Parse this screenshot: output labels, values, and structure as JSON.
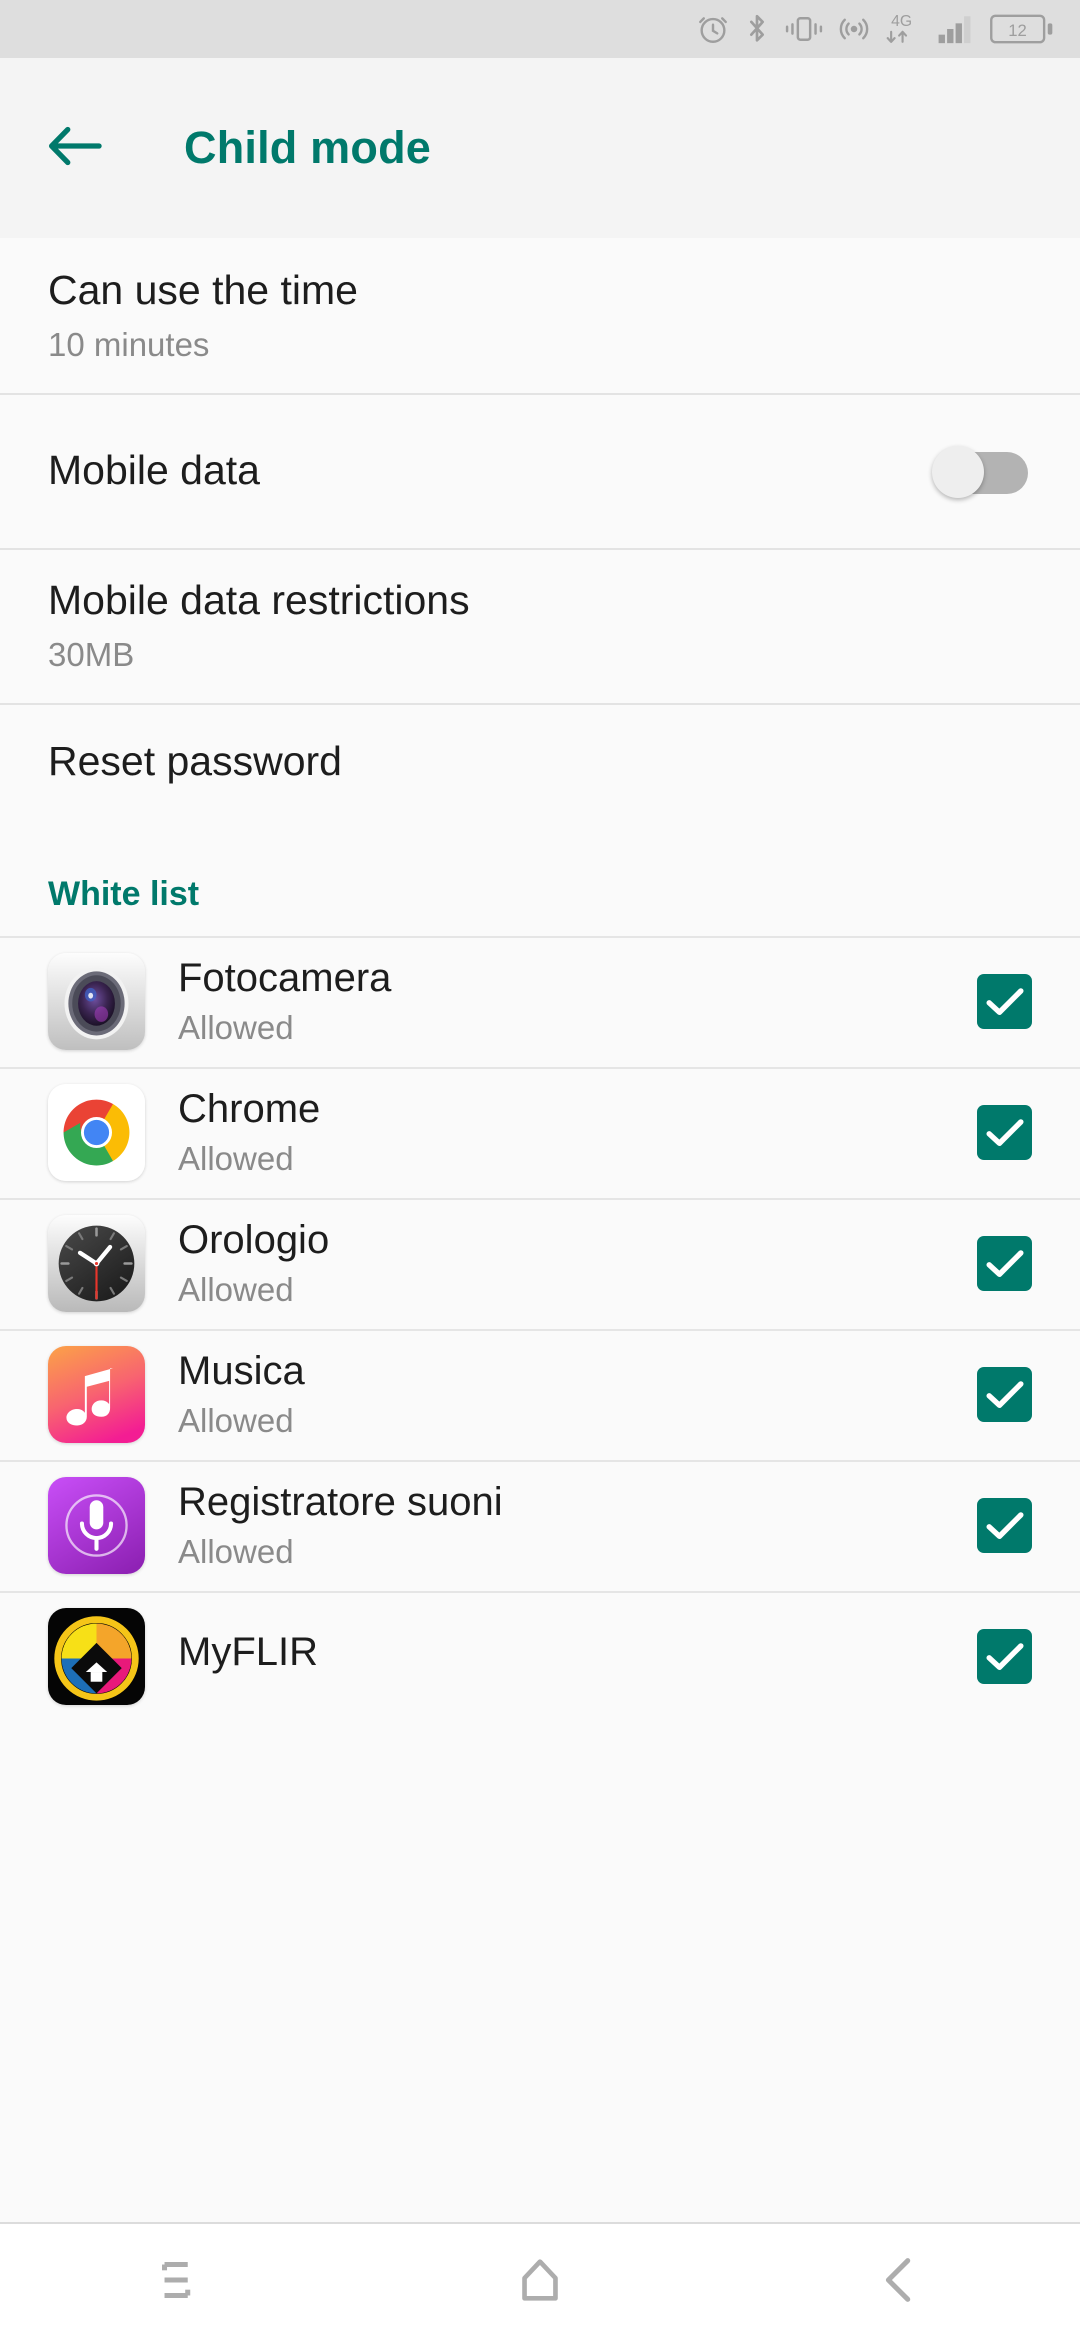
{
  "statusbar": {
    "icons": [
      {
        "name": "alarm-icon",
        "label": "Alarm set"
      },
      {
        "name": "bluetooth-icon",
        "label": "Bluetooth"
      },
      {
        "name": "vibrate-icon",
        "label": "Vibrate mode"
      },
      {
        "name": "hotspot-icon",
        "label": "Hotspot"
      },
      {
        "name": "mobile-network-icon",
        "label": "4G"
      },
      {
        "name": "signal-bars-icon",
        "label": "Signal"
      },
      {
        "name": "battery-icon",
        "label": "Battery"
      }
    ],
    "network_type": "4G",
    "battery_level": "12"
  },
  "appbar": {
    "title": "Child mode",
    "back_icon": "arrow-left-icon"
  },
  "settings": [
    {
      "key": "can-use-the-time",
      "title": "Can use the time",
      "subtitle": "10 minutes",
      "control": "none"
    },
    {
      "key": "mobile-data",
      "title": "Mobile data",
      "subtitle": "",
      "control": "toggle",
      "toggle_on": false
    },
    {
      "key": "mobile-data-restrictions",
      "title": "Mobile data restrictions",
      "subtitle": "30MB",
      "control": "none"
    },
    {
      "key": "reset-password",
      "title": "Reset password",
      "subtitle": "",
      "control": "none"
    }
  ],
  "whitelist": {
    "header": "White list",
    "apps": [
      {
        "key": "fotocamera",
        "name": "Fotocamera",
        "state": "Allowed",
        "checked": true,
        "icon": "camera-icon"
      },
      {
        "key": "chrome",
        "name": "Chrome",
        "state": "Allowed",
        "checked": true,
        "icon": "chrome-icon"
      },
      {
        "key": "orologio",
        "name": "Orologio",
        "state": "Allowed",
        "checked": true,
        "icon": "clock-icon"
      },
      {
        "key": "musica",
        "name": "Musica",
        "state": "Allowed",
        "checked": true,
        "icon": "music-icon"
      },
      {
        "key": "registratore-suoni",
        "name": "Registratore suoni",
        "state": "Allowed",
        "checked": true,
        "icon": "microphone-icon"
      },
      {
        "key": "myflir",
        "name": "MyFLIR",
        "state": "",
        "checked": true,
        "icon": "myflir-icon"
      }
    ]
  },
  "navbar": {
    "buttons": [
      {
        "key": "recents",
        "label": "Recents",
        "icon": "recents-icon"
      },
      {
        "key": "home",
        "label": "Home",
        "icon": "home-icon"
      },
      {
        "key": "back",
        "label": "Back",
        "icon": "back-chevron-icon"
      }
    ]
  },
  "colors": {
    "accent": "#00796b",
    "background": "#fafafa",
    "appbar": "#f4f4f4",
    "statusbar": "#dedede",
    "primary_text": "#1d1d1d",
    "secondary_text": "#8a8a8a",
    "divider": "#e5e5e5"
  }
}
